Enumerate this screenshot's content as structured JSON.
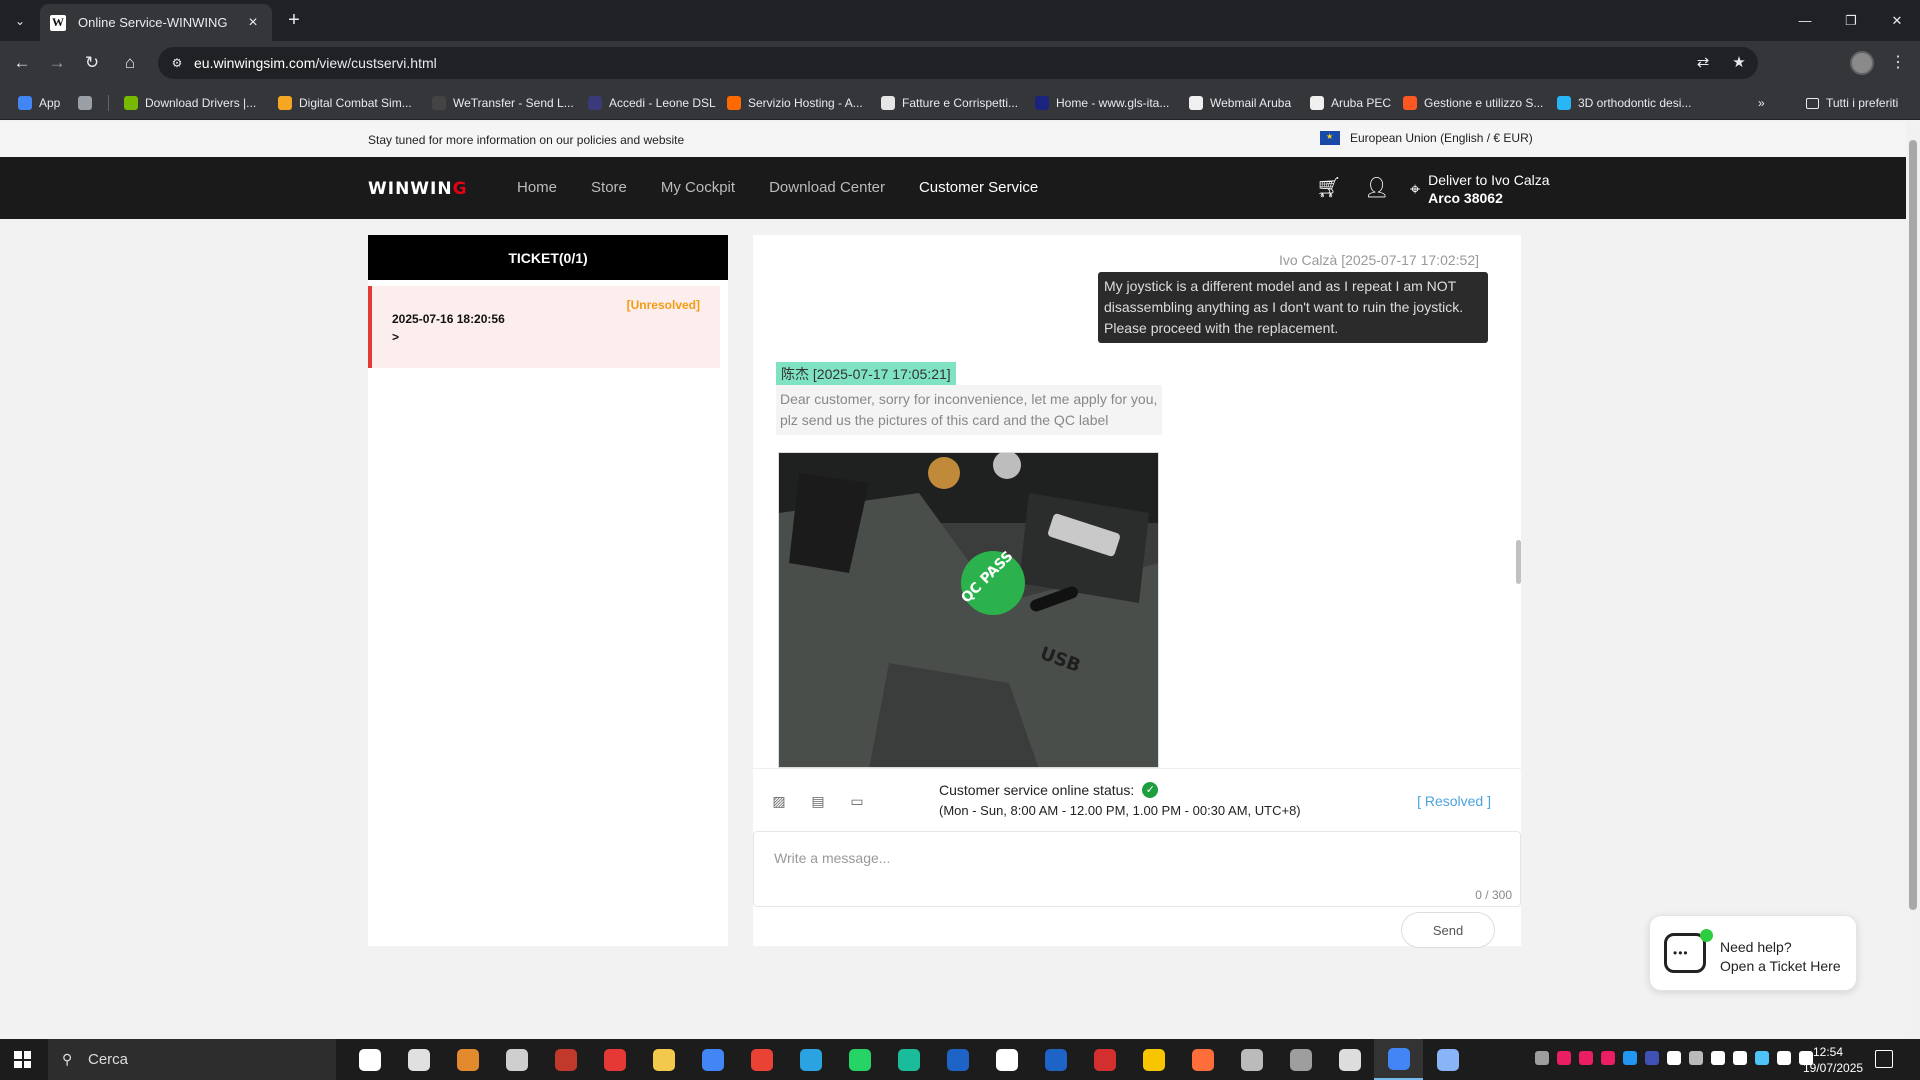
{
  "browser": {
    "tab_title": "Online Service-WINWING",
    "tab_favicon_letter": "W",
    "url_host": "eu.winwingsim.com",
    "url_path": "/view/custservi.html",
    "bookmarks": [
      {
        "label": "App",
        "color": "#4285f4"
      },
      {
        "label": "Download Drivers |...",
        "color": "#76b900"
      },
      {
        "label": "Digital Combat Sim...",
        "color": "#f5a623"
      },
      {
        "label": "WeTransfer - Send L...",
        "color": "#444444"
      },
      {
        "label": "Accedi - Leone DSL",
        "color": "#3a3a7a"
      },
      {
        "label": "Servizio Hosting - A...",
        "color": "#ff6a00"
      },
      {
        "label": "Fatture e Corrispetti...",
        "color": "#e6e6e6"
      },
      {
        "label": "Home - www.gls-ita...",
        "color": "#1a237e"
      },
      {
        "label": "Webmail Aruba",
        "color": "#f0f0f0"
      },
      {
        "label": "Aruba PEC",
        "color": "#f0f0f0"
      },
      {
        "label": "Gestione e utilizzo S...",
        "color": "#ff5722"
      },
      {
        "label": "3D orthodontic desi...",
        "color": "#29b6f6"
      }
    ],
    "bookmarks_folder": "Tutti i preferiti"
  },
  "site": {
    "notice": "Stay tuned for more information on our policies and website",
    "region": "European Union (English / € EUR)",
    "logo_main": "WINWIN",
    "logo_accent": "G",
    "nav": [
      "Home",
      "Store",
      "My Cockpit",
      "Download Center",
      "Customer Service"
    ],
    "deliver_line1": "Deliver to Ivo Calza",
    "deliver_line2": "Arco 38062"
  },
  "tickets": {
    "header": "TICKET(0/1)",
    "items": [
      {
        "status": "[Unresolved]",
        "date": "2025-07-16 18:20:56",
        "arrow": ">"
      }
    ]
  },
  "chat": {
    "messages": [
      {
        "side": "right",
        "meta": "Ivo Calzà [2025-07-17 17:02:52]",
        "text": "My joystick is a different model and as I repeat I am NOT disassembling anything as I don't want to ruin the joystick. Please proceed with the replacement."
      },
      {
        "side": "left",
        "meta": "陈杰 [2025-07-17 17:05:21]",
        "text": "Dear customer, sorry for inconvenience, let me apply for you, plz send us the pictures of this card and the QC label",
        "image_label": "QC PASS",
        "image_port_label": "USB"
      }
    ],
    "status_label": "Customer service online status:",
    "hours": "(Mon - Sun, 8:00 AM - 12.00 PM, 1.00 PM - 00:30 AM, UTC+8)",
    "resolved_link": "[ Resolved ]",
    "input_placeholder": "Write a message...",
    "counter": "0 / 300",
    "send_label": "Send"
  },
  "help_widget": {
    "line1": "Need help?",
    "line2": "Open a Ticket Here"
  },
  "taskbar": {
    "search_placeholder": "Cerca",
    "time": "12:54",
    "date": "19/07/2025",
    "apps": [
      "#ffffff",
      "#e0e0e0",
      "#e38a2e",
      "#cfcfcf",
      "#c0392b",
      "#e53935",
      "#f2c94c",
      "#4285f4",
      "#ea4335",
      "#2aa3e0",
      "#25d366",
      "#1abc9c",
      "#1e63c6",
      "#ffffff",
      "#1e63c6",
      "#d32f2f",
      "#f9c400",
      "#ff6d3b",
      "#bbbbbb",
      "#9e9e9e",
      "#dddddd",
      "#4285f4",
      "#8ab4f8"
    ]
  },
  "colors": {
    "accent_red": "#e60012",
    "unresolved": "#f39c12",
    "link_blue": "#4aa3df",
    "online_green": "#1e9e3e"
  }
}
